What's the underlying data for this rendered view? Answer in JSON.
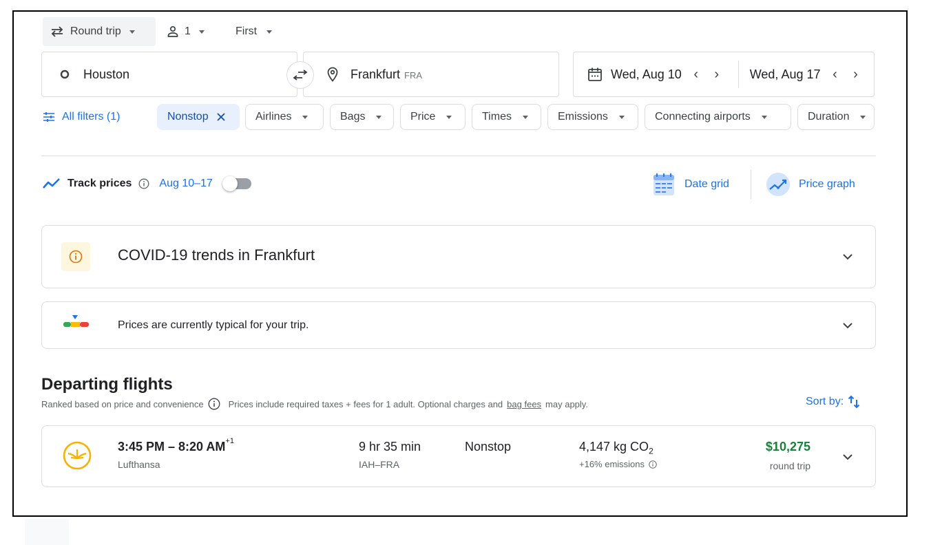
{
  "search": {
    "trip_type": "Round trip",
    "passengers": "1",
    "cabin_class": "First",
    "origin": "Houston",
    "destination": "Frankfurt",
    "destination_code": "FRA",
    "depart_date": "Wed, Aug 10",
    "return_date": "Wed, Aug 17"
  },
  "filters": {
    "all_filters": "All filters (1)",
    "chips": {
      "nonstop": "Nonstop",
      "airlines": "Airlines",
      "bags": "Bags",
      "price": "Price",
      "times": "Times",
      "emissions": "Emissions",
      "connecting": "Connecting airports",
      "duration": "Duration"
    }
  },
  "track": {
    "title": "Track prices",
    "dates": "Aug 10–17",
    "enabled": false
  },
  "views": {
    "date_grid": "Date grid",
    "price_graph": "Price graph"
  },
  "covid": {
    "title": "COVID-19 trends in Frankfurt"
  },
  "price_insight": {
    "text": "Prices are currently typical for your trip."
  },
  "departing": {
    "title": "Departing flights",
    "ranking": "Ranked based on price and convenience",
    "note_prefix": "Prices include required taxes + fees for 1 adult. Optional charges and",
    "note_link": "bag fees",
    "note_suffix": "may apply.",
    "sort_label": "Sort by:"
  },
  "flights": [
    {
      "times": "3:45 PM – 8:20 AM",
      "day_offset": "+1",
      "airline": "Lufthansa",
      "duration": "9 hr 35 min",
      "route": "IAH–FRA",
      "stops": "Nonstop",
      "co2_value": "4,147 kg CO",
      "co2_sub": "2",
      "emissions": "+16% emissions",
      "price": "$10,275",
      "price_type": "round trip"
    }
  ],
  "colors": {
    "accent": "#1a73e8",
    "price_green": "#188038",
    "chip_selected_bg": "#e8f0fe",
    "lufthansa_yellow": "#f9b000"
  }
}
